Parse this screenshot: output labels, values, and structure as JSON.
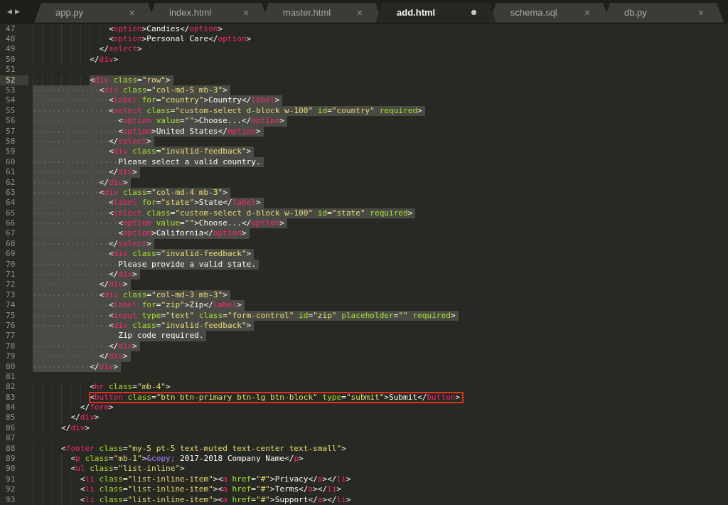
{
  "tab_bar": {
    "scroll_left": "◀",
    "scroll_right": "▶",
    "tabs": [
      {
        "label": "app.py",
        "selected": false,
        "modified": false,
        "close": "×"
      },
      {
        "label": "index.html",
        "selected": false,
        "modified": false,
        "close": "×"
      },
      {
        "label": "master.html",
        "selected": false,
        "modified": false,
        "close": "×"
      },
      {
        "label": "add.html",
        "selected": true,
        "modified": true
      },
      {
        "label": "schema.sql",
        "selected": false,
        "modified": false,
        "close": "×"
      },
      {
        "label": "db.py",
        "selected": false,
        "modified": false,
        "close": "×"
      }
    ]
  },
  "editor": {
    "lines": [
      {
        "number": "47",
        "selected": false,
        "indent_selected": false,
        "current": false,
        "boxed": false,
        "tokens": [
          {
            "kind": "p",
            "text": "                <"
          },
          {
            "kind": "t",
            "text": "option"
          },
          {
            "kind": "p",
            "text": ">Candies</"
          },
          {
            "kind": "t",
            "text": "option"
          },
          {
            "kind": "p",
            "text": ">"
          }
        ]
      },
      {
        "number": "48",
        "selected": false,
        "indent_selected": false,
        "current": false,
        "boxed": false,
        "tokens": [
          {
            "kind": "p",
            "text": "                <"
          },
          {
            "kind": "t",
            "text": "option"
          },
          {
            "kind": "p",
            "text": ">Personal Care</"
          },
          {
            "kind": "t",
            "text": "option"
          },
          {
            "kind": "p",
            "text": ">"
          }
        ]
      },
      {
        "number": "49",
        "selected": false,
        "indent_selected": false,
        "current": false,
        "boxed": false,
        "tokens": [
          {
            "kind": "p",
            "text": "              </"
          },
          {
            "kind": "t",
            "text": "select"
          },
          {
            "kind": "p",
            "text": ">"
          }
        ]
      },
      {
        "number": "50",
        "selected": false,
        "indent_selected": false,
        "current": false,
        "boxed": false,
        "tokens": [
          {
            "kind": "p",
            "text": "            </"
          },
          {
            "kind": "t",
            "text": "div"
          },
          {
            "kind": "p",
            "text": ">"
          }
        ]
      },
      {
        "number": "51",
        "current": false
      },
      {
        "number": "52",
        "selected": true,
        "indent_selected": false,
        "current": true,
        "boxed": false,
        "tokens": [
          {
            "kind": "p",
            "text": "            <"
          },
          {
            "kind": "t",
            "text": "div"
          },
          {
            "kind": "a",
            "text": " class"
          },
          {
            "kind": "p",
            "text": "="
          },
          {
            "kind": "s",
            "text": "\"row\""
          },
          {
            "kind": "p",
            "text": ">"
          }
        ]
      },
      {
        "number": "53",
        "selected": true,
        "indent_selected": true,
        "current": false,
        "boxed": false,
        "tokens": [
          {
            "kind": "p",
            "text": "              <"
          },
          {
            "kind": "t",
            "text": "div"
          },
          {
            "kind": "a",
            "text": " class"
          },
          {
            "kind": "p",
            "text": "="
          },
          {
            "kind": "s",
            "text": "\"col-md-5 mb-3\""
          },
          {
            "kind": "p",
            "text": ">"
          }
        ]
      },
      {
        "number": "54",
        "selected": true,
        "indent_selected": true,
        "current": false,
        "boxed": false,
        "tokens": [
          {
            "kind": "p",
            "text": "                <"
          },
          {
            "kind": "t",
            "text": "label"
          },
          {
            "kind": "a",
            "text": " for"
          },
          {
            "kind": "p",
            "text": "="
          },
          {
            "kind": "s",
            "text": "\"country\""
          },
          {
            "kind": "p",
            "text": ">Country</"
          },
          {
            "kind": "t",
            "text": "label"
          },
          {
            "kind": "p",
            "text": ">"
          }
        ]
      },
      {
        "number": "55",
        "selected": true,
        "indent_selected": true,
        "current": false,
        "boxed": false,
        "tokens": [
          {
            "kind": "p",
            "text": "                <"
          },
          {
            "kind": "t",
            "text": "select"
          },
          {
            "kind": "a",
            "text": " class"
          },
          {
            "kind": "p",
            "text": "="
          },
          {
            "kind": "s",
            "text": "\"custom-select d-block w-100\""
          },
          {
            "kind": "a",
            "text": " id"
          },
          {
            "kind": "p",
            "text": "="
          },
          {
            "kind": "s",
            "text": "\"country\""
          },
          {
            "kind": "a",
            "text": " required"
          },
          {
            "kind": "p",
            "text": ">"
          }
        ]
      },
      {
        "number": "56",
        "selected": true,
        "indent_selected": true,
        "current": false,
        "boxed": false,
        "tokens": [
          {
            "kind": "p",
            "text": "                  <"
          },
          {
            "kind": "t",
            "text": "option"
          },
          {
            "kind": "a",
            "text": " value"
          },
          {
            "kind": "p",
            "text": "="
          },
          {
            "kind": "s",
            "text": "\"\""
          },
          {
            "kind": "p",
            "text": ">Choose...</"
          },
          {
            "kind": "t",
            "text": "option"
          },
          {
            "kind": "p",
            "text": ">"
          }
        ]
      },
      {
        "number": "57",
        "selected": true,
        "indent_selected": true,
        "current": false,
        "boxed": false,
        "tokens": [
          {
            "kind": "p",
            "text": "                  <"
          },
          {
            "kind": "t",
            "text": "option"
          },
          {
            "kind": "p",
            "text": ">United States</"
          },
          {
            "kind": "t",
            "text": "option"
          },
          {
            "kind": "p",
            "text": ">"
          }
        ]
      },
      {
        "number": "58",
        "selected": true,
        "indent_selected": true,
        "current": false,
        "boxed": false,
        "tokens": [
          {
            "kind": "p",
            "text": "                </"
          },
          {
            "kind": "t",
            "text": "select"
          },
          {
            "kind": "p",
            "text": ">"
          }
        ]
      },
      {
        "number": "59",
        "selected": true,
        "indent_selected": true,
        "current": false,
        "boxed": false,
        "tokens": [
          {
            "kind": "p",
            "text": "                <"
          },
          {
            "kind": "t",
            "text": "div"
          },
          {
            "kind": "a",
            "text": " class"
          },
          {
            "kind": "p",
            "text": "="
          },
          {
            "kind": "s",
            "text": "\"invalid-feedback\""
          },
          {
            "kind": "p",
            "text": ">"
          }
        ]
      },
      {
        "number": "60",
        "selected": true,
        "indent_selected": true,
        "current": false,
        "boxed": false,
        "tokens": [
          {
            "kind": "p",
            "text": "                  Please select a valid country."
          }
        ]
      },
      {
        "number": "61",
        "selected": true,
        "indent_selected": true,
        "current": false,
        "boxed": false,
        "tokens": [
          {
            "kind": "p",
            "text": "                </"
          },
          {
            "kind": "t",
            "text": "div"
          },
          {
            "kind": "p",
            "text": ">"
          }
        ]
      },
      {
        "number": "62",
        "selected": true,
        "indent_selected": true,
        "current": false,
        "boxed": false,
        "tokens": [
          {
            "kind": "p",
            "text": "              </"
          },
          {
            "kind": "t",
            "text": "div"
          },
          {
            "kind": "p",
            "text": ">"
          }
        ]
      },
      {
        "number": "63",
        "selected": true,
        "indent_selected": true,
        "current": false,
        "boxed": false,
        "tokens": [
          {
            "kind": "p",
            "text": "              <"
          },
          {
            "kind": "t",
            "text": "div"
          },
          {
            "kind": "a",
            "text": " class"
          },
          {
            "kind": "p",
            "text": "="
          },
          {
            "kind": "s",
            "text": "\"col-md-4 mb-3\""
          },
          {
            "kind": "p",
            "text": ">"
          }
        ]
      },
      {
        "number": "64",
        "selected": true,
        "indent_selected": true,
        "current": false,
        "boxed": false,
        "tokens": [
          {
            "kind": "p",
            "text": "                <"
          },
          {
            "kind": "t",
            "text": "label"
          },
          {
            "kind": "a",
            "text": " for"
          },
          {
            "kind": "p",
            "text": "="
          },
          {
            "kind": "s",
            "text": "\"state\""
          },
          {
            "kind": "p",
            "text": ">State</"
          },
          {
            "kind": "t",
            "text": "label"
          },
          {
            "kind": "p",
            "text": ">"
          }
        ]
      },
      {
        "number": "65",
        "selected": true,
        "indent_selected": true,
        "current": false,
        "boxed": false,
        "tokens": [
          {
            "kind": "p",
            "text": "                <"
          },
          {
            "kind": "t",
            "text": "select"
          },
          {
            "kind": "a",
            "text": " class"
          },
          {
            "kind": "p",
            "text": "="
          },
          {
            "kind": "s",
            "text": "\"custom-select d-block w-100\""
          },
          {
            "kind": "a",
            "text": " id"
          },
          {
            "kind": "p",
            "text": "="
          },
          {
            "kind": "s",
            "text": "\"state\""
          },
          {
            "kind": "a",
            "text": " required"
          },
          {
            "kind": "p",
            "text": ">"
          }
        ]
      },
      {
        "number": "66",
        "selected": true,
        "indent_selected": true,
        "current": false,
        "boxed": false,
        "tokens": [
          {
            "kind": "p",
            "text": "                  <"
          },
          {
            "kind": "t",
            "text": "option"
          },
          {
            "kind": "a",
            "text": " value"
          },
          {
            "kind": "p",
            "text": "="
          },
          {
            "kind": "s",
            "text": "\"\""
          },
          {
            "kind": "p",
            "text": ">Choose...</"
          },
          {
            "kind": "t",
            "text": "option"
          },
          {
            "kind": "p",
            "text": ">"
          }
        ]
      },
      {
        "number": "67",
        "selected": true,
        "indent_selected": true,
        "current": false,
        "boxed": false,
        "tokens": [
          {
            "kind": "p",
            "text": "                  <"
          },
          {
            "kind": "t",
            "text": "option"
          },
          {
            "kind": "p",
            "text": ">California</"
          },
          {
            "kind": "t",
            "text": "option"
          },
          {
            "kind": "p",
            "text": ">"
          }
        ]
      },
      {
        "number": "68",
        "selected": true,
        "indent_selected": true,
        "current": false,
        "boxed": false,
        "tokens": [
          {
            "kind": "p",
            "text": "                </"
          },
          {
            "kind": "t",
            "text": "select"
          },
          {
            "kind": "p",
            "text": ">"
          }
        ]
      },
      {
        "number": "69",
        "selected": true,
        "indent_selected": true,
        "current": false,
        "boxed": false,
        "tokens": [
          {
            "kind": "p",
            "text": "                <"
          },
          {
            "kind": "t",
            "text": "div"
          },
          {
            "kind": "a",
            "text": " class"
          },
          {
            "kind": "p",
            "text": "="
          },
          {
            "kind": "s",
            "text": "\"invalid-feedback\""
          },
          {
            "kind": "p",
            "text": ">"
          }
        ]
      },
      {
        "number": "70",
        "selected": true,
        "indent_selected": true,
        "current": false,
        "boxed": false,
        "tokens": [
          {
            "kind": "p",
            "text": "                  Please provide a valid state."
          }
        ]
      },
      {
        "number": "71",
        "selected": true,
        "indent_selected": true,
        "current": false,
        "boxed": false,
        "tokens": [
          {
            "kind": "p",
            "text": "                </"
          },
          {
            "kind": "t",
            "text": "div"
          },
          {
            "kind": "p",
            "text": ">"
          }
        ]
      },
      {
        "number": "72",
        "selected": true,
        "indent_selected": true,
        "current": false,
        "boxed": false,
        "tokens": [
          {
            "kind": "p",
            "text": "              </"
          },
          {
            "kind": "t",
            "text": "div"
          },
          {
            "kind": "p",
            "text": ">"
          }
        ]
      },
      {
        "number": "73",
        "selected": true,
        "indent_selected": true,
        "current": false,
        "boxed": false,
        "tokens": [
          {
            "kind": "p",
            "text": "              <"
          },
          {
            "kind": "t",
            "text": "div"
          },
          {
            "kind": "a",
            "text": " class"
          },
          {
            "kind": "p",
            "text": "="
          },
          {
            "kind": "s",
            "text": "\"col-md-3 mb-3\""
          },
          {
            "kind": "p",
            "text": ">"
          }
        ]
      },
      {
        "number": "74",
        "selected": true,
        "indent_selected": true,
        "current": false,
        "boxed": false,
        "tokens": [
          {
            "kind": "p",
            "text": "                <"
          },
          {
            "kind": "t",
            "text": "label"
          },
          {
            "kind": "a",
            "text": " for"
          },
          {
            "kind": "p",
            "text": "="
          },
          {
            "kind": "s",
            "text": "\"zip\""
          },
          {
            "kind": "p",
            "text": ">Zip</"
          },
          {
            "kind": "t",
            "text": "label"
          },
          {
            "kind": "p",
            "text": ">"
          }
        ]
      },
      {
        "number": "75",
        "selected": true,
        "indent_selected": true,
        "current": false,
        "boxed": false,
        "tokens": [
          {
            "kind": "p",
            "text": "                <"
          },
          {
            "kind": "t",
            "text": "input"
          },
          {
            "kind": "a",
            "text": " type"
          },
          {
            "kind": "p",
            "text": "="
          },
          {
            "kind": "s",
            "text": "\"text\""
          },
          {
            "kind": "a",
            "text": " class"
          },
          {
            "kind": "p",
            "text": "="
          },
          {
            "kind": "s",
            "text": "\"form-control\""
          },
          {
            "kind": "a",
            "text": " id"
          },
          {
            "kind": "p",
            "text": "="
          },
          {
            "kind": "s",
            "text": "\"zip\""
          },
          {
            "kind": "a",
            "text": " placeholder"
          },
          {
            "kind": "p",
            "text": "="
          },
          {
            "kind": "s",
            "text": "\"\""
          },
          {
            "kind": "a",
            "text": " required"
          },
          {
            "kind": "p",
            "text": ">"
          }
        ]
      },
      {
        "number": "76",
        "selected": true,
        "indent_selected": true,
        "current": false,
        "boxed": false,
        "tokens": [
          {
            "kind": "p",
            "text": "                <"
          },
          {
            "kind": "t",
            "text": "div"
          },
          {
            "kind": "a",
            "text": " class"
          },
          {
            "kind": "p",
            "text": "="
          },
          {
            "kind": "s",
            "text": "\"invalid-feedback\""
          },
          {
            "kind": "p",
            "text": ">"
          }
        ]
      },
      {
        "number": "77",
        "selected": true,
        "indent_selected": true,
        "current": false,
        "boxed": false,
        "tokens": [
          {
            "kind": "p",
            "text": "                  Zip code required."
          }
        ]
      },
      {
        "number": "78",
        "selected": true,
        "indent_selected": true,
        "current": false,
        "boxed": false,
        "tokens": [
          {
            "kind": "p",
            "text": "                </"
          },
          {
            "kind": "t",
            "text": "div"
          },
          {
            "kind": "p",
            "text": ">"
          }
        ]
      },
      {
        "number": "79",
        "selected": true,
        "indent_selected": true,
        "current": false,
        "boxed": false,
        "tokens": [
          {
            "kind": "p",
            "text": "              </"
          },
          {
            "kind": "t",
            "text": "div"
          },
          {
            "kind": "p",
            "text": ">"
          }
        ]
      },
      {
        "number": "80",
        "selected": true,
        "indent_selected": true,
        "current": false,
        "boxed": false,
        "tokens": [
          {
            "kind": "p",
            "text": "            </"
          },
          {
            "kind": "t",
            "text": "div"
          },
          {
            "kind": "p",
            "text": ">"
          }
        ]
      },
      {
        "number": "81",
        "current": false
      },
      {
        "number": "82",
        "selected": false,
        "indent_selected": false,
        "current": false,
        "boxed": false,
        "tokens": [
          {
            "kind": "p",
            "text": "            <"
          },
          {
            "kind": "t",
            "text": "hr"
          },
          {
            "kind": "a",
            "text": " class"
          },
          {
            "kind": "p",
            "text": "="
          },
          {
            "kind": "s",
            "text": "\"mb-4\""
          },
          {
            "kind": "p",
            "text": ">"
          }
        ]
      },
      {
        "number": "83",
        "selected": false,
        "indent_selected": false,
        "current": false,
        "boxed": true,
        "tokens": [
          {
            "kind": "p",
            "text": "            <"
          },
          {
            "kind": "t",
            "text": "button"
          },
          {
            "kind": "a",
            "text": " class"
          },
          {
            "kind": "p",
            "text": "="
          },
          {
            "kind": "s",
            "text": "\"btn btn-primary btn-lg btn-block\""
          },
          {
            "kind": "a",
            "text": " type"
          },
          {
            "kind": "p",
            "text": "="
          },
          {
            "kind": "s",
            "text": "\"submit\""
          },
          {
            "kind": "p",
            "text": ">Submit</"
          },
          {
            "kind": "t",
            "text": "button"
          },
          {
            "kind": "p",
            "text": ">"
          }
        ]
      },
      {
        "number": "84",
        "selected": false,
        "indent_selected": false,
        "current": false,
        "boxed": false,
        "tokens": [
          {
            "kind": "p",
            "text": "          </"
          },
          {
            "kind": "t",
            "text": "form"
          },
          {
            "kind": "p",
            "text": ">"
          }
        ]
      },
      {
        "number": "85",
        "selected": false,
        "indent_selected": false,
        "current": false,
        "boxed": false,
        "tokens": [
          {
            "kind": "p",
            "text": "        </"
          },
          {
            "kind": "t",
            "text": "div"
          },
          {
            "kind": "p",
            "text": ">"
          }
        ]
      },
      {
        "number": "86",
        "selected": false,
        "indent_selected": false,
        "current": false,
        "boxed": false,
        "tokens": [
          {
            "kind": "p",
            "text": "      </"
          },
          {
            "kind": "t",
            "text": "div"
          },
          {
            "kind": "p",
            "text": ">"
          }
        ]
      },
      {
        "number": "87",
        "current": false
      },
      {
        "number": "88",
        "selected": false,
        "indent_selected": false,
        "current": false,
        "boxed": false,
        "tokens": [
          {
            "kind": "p",
            "text": "      <"
          },
          {
            "kind": "t",
            "text": "footer"
          },
          {
            "kind": "a",
            "text": " class"
          },
          {
            "kind": "p",
            "text": "="
          },
          {
            "kind": "s",
            "text": "\"my-5 pt-5 text-muted text-center text-small\""
          },
          {
            "kind": "p",
            "text": ">"
          }
        ]
      },
      {
        "number": "89",
        "selected": false,
        "indent_selected": false,
        "current": false,
        "boxed": false,
        "tokens": [
          {
            "kind": "p",
            "text": "        <"
          },
          {
            "kind": "t",
            "text": "p"
          },
          {
            "kind": "a",
            "text": " class"
          },
          {
            "kind": "p",
            "text": "="
          },
          {
            "kind": "s",
            "text": "\"mb-1\""
          },
          {
            "kind": "p",
            "text": ">"
          },
          {
            "kind": "e",
            "text": "&copy;"
          },
          {
            "kind": "p",
            "text": " 2017-2018 Company Name</"
          },
          {
            "kind": "t",
            "text": "p"
          },
          {
            "kind": "p",
            "text": ">"
          }
        ]
      },
      {
        "number": "90",
        "selected": false,
        "indent_selected": false,
        "current": false,
        "boxed": false,
        "tokens": [
          {
            "kind": "p",
            "text": "        <"
          },
          {
            "kind": "t",
            "text": "ul"
          },
          {
            "kind": "a",
            "text": " class"
          },
          {
            "kind": "p",
            "text": "="
          },
          {
            "kind": "s",
            "text": "\"list-inline\""
          },
          {
            "kind": "p",
            "text": ">"
          }
        ]
      },
      {
        "number": "91",
        "selected": false,
        "indent_selected": false,
        "current": false,
        "boxed": false,
        "tokens": [
          {
            "kind": "p",
            "text": "          <"
          },
          {
            "kind": "t",
            "text": "li"
          },
          {
            "kind": "a",
            "text": " class"
          },
          {
            "kind": "p",
            "text": "="
          },
          {
            "kind": "s",
            "text": "\"list-inline-item\""
          },
          {
            "kind": "p",
            "text": "><"
          },
          {
            "kind": "t",
            "text": "a"
          },
          {
            "kind": "a",
            "text": " href"
          },
          {
            "kind": "p",
            "text": "="
          },
          {
            "kind": "s",
            "text": "\"#\""
          },
          {
            "kind": "p",
            "text": ">Privacy</"
          },
          {
            "kind": "t",
            "text": "a"
          },
          {
            "kind": "p",
            "text": "></"
          },
          {
            "kind": "t",
            "text": "li"
          },
          {
            "kind": "p",
            "text": ">"
          }
        ]
      },
      {
        "number": "92",
        "selected": false,
        "indent_selected": false,
        "current": false,
        "boxed": false,
        "tokens": [
          {
            "kind": "p",
            "text": "          <"
          },
          {
            "kind": "t",
            "text": "li"
          },
          {
            "kind": "a",
            "text": " class"
          },
          {
            "kind": "p",
            "text": "="
          },
          {
            "kind": "s",
            "text": "\"list-inline-item\""
          },
          {
            "kind": "p",
            "text": "><"
          },
          {
            "kind": "t",
            "text": "a"
          },
          {
            "kind": "a",
            "text": " href"
          },
          {
            "kind": "p",
            "text": "="
          },
          {
            "kind": "s",
            "text": "\"#\""
          },
          {
            "kind": "p",
            "text": ">Terms</"
          },
          {
            "kind": "t",
            "text": "a"
          },
          {
            "kind": "p",
            "text": "></"
          },
          {
            "kind": "t",
            "text": "li"
          },
          {
            "kind": "p",
            "text": ">"
          }
        ]
      },
      {
        "number": "93",
        "selected": false,
        "indent_selected": false,
        "current": false,
        "boxed": false,
        "tokens": [
          {
            "kind": "p",
            "text": "          <"
          },
          {
            "kind": "t",
            "text": "li"
          },
          {
            "kind": "a",
            "text": " class"
          },
          {
            "kind": "p",
            "text": "="
          },
          {
            "kind": "s",
            "text": "\"list-inline-item\""
          },
          {
            "kind": "p",
            "text": "><"
          },
          {
            "kind": "t",
            "text": "a"
          },
          {
            "kind": "a",
            "text": " href"
          },
          {
            "kind": "p",
            "text": "="
          },
          {
            "kind": "s",
            "text": "\"#\""
          },
          {
            "kind": "p",
            "text": ">Support</"
          },
          {
            "kind": "t",
            "text": "a"
          },
          {
            "kind": "p",
            "text": "></"
          },
          {
            "kind": "t",
            "text": "li"
          },
          {
            "kind": "p",
            "text": ">"
          }
        ]
      }
    ]
  }
}
